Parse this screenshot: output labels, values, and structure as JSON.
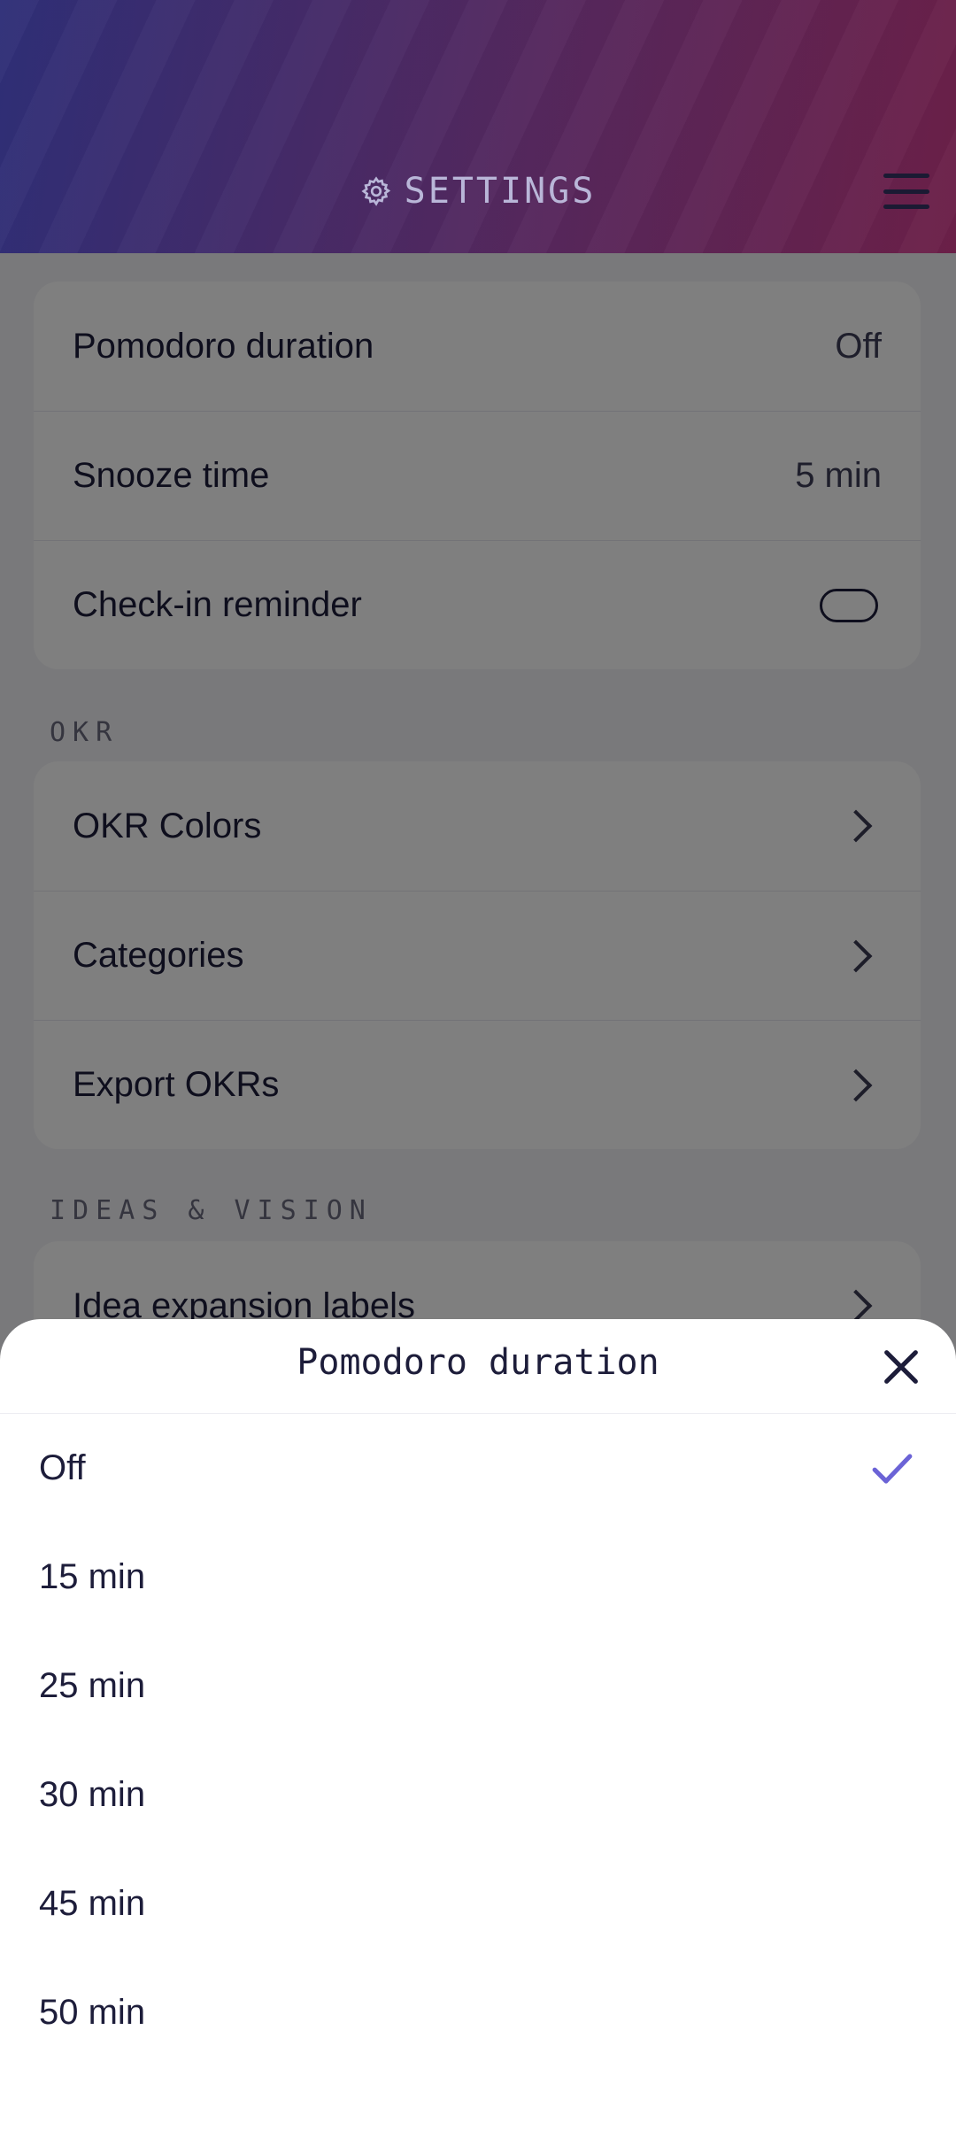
{
  "header": {
    "title": "SETTINGS",
    "gear_icon": "gear-icon",
    "menu_icon": "hamburger-menu-icon",
    "gradient_start": "#2f2f78",
    "gradient_end": "#6c2048"
  },
  "timer_card": {
    "rows": [
      {
        "label": "Pomodoro duration",
        "value": "Off"
      },
      {
        "label": "Snooze time",
        "value": "5 min"
      },
      {
        "label": "Check-in reminder",
        "toggle_on": false
      }
    ]
  },
  "okr_section": {
    "label": "OKR",
    "rows": [
      {
        "label": "OKR Colors"
      },
      {
        "label": "Categories"
      },
      {
        "label": "Export OKRs"
      }
    ]
  },
  "ideas_section": {
    "label": "IDEAS & VISION",
    "rows": [
      {
        "label": "Idea expansion labels"
      }
    ]
  },
  "sheet": {
    "title": "Pomodoro duration",
    "close_icon": "close-icon",
    "options": [
      "Off",
      "15 min",
      "25 min",
      "30 min",
      "45 min",
      "50 min"
    ],
    "selected": "Off",
    "check_color": "#6b63d6"
  }
}
